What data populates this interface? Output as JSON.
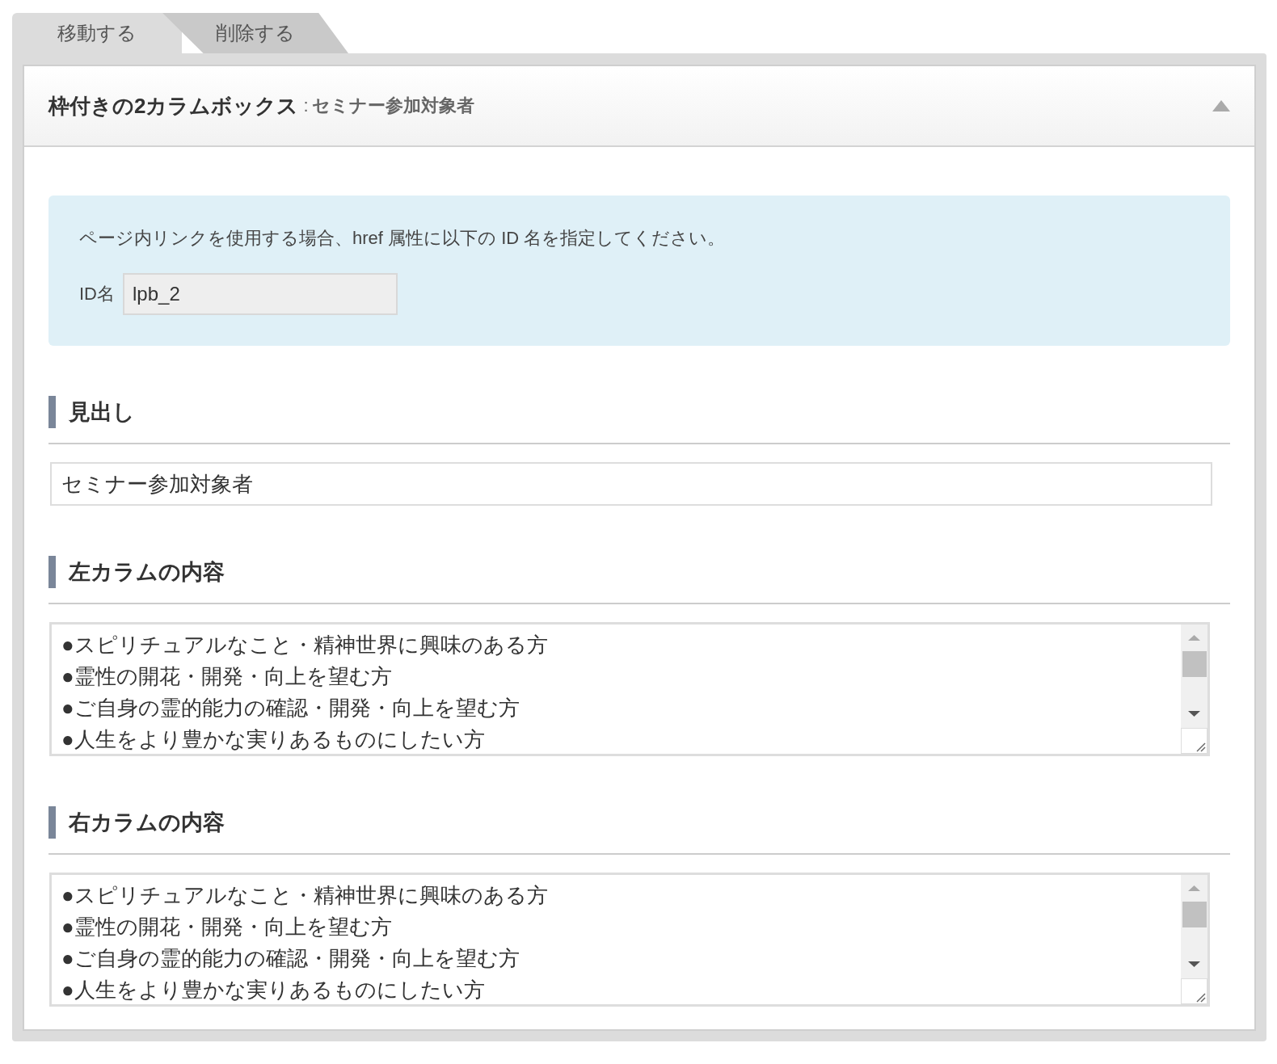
{
  "tabs": [
    {
      "label": "移動する"
    },
    {
      "label": "削除する"
    }
  ],
  "panel": {
    "title": "枠付きの2カラムボックス",
    "separator": ":",
    "subtitle": "セミナー参加対象者",
    "expanded": true
  },
  "notice": {
    "text": "ページ内リンクを使用する場合、href 属性に以下の ID 名を指定してください。",
    "id_label": "ID名",
    "id_value": "lpb_2"
  },
  "fields": [
    {
      "kind": "input",
      "label": "見出し",
      "value": "セミナー参加対象者"
    },
    {
      "kind": "textarea",
      "label": "左カラムの内容",
      "lines": [
        "●スピリチュアルなこと・精神世界に興味のある方",
        "●霊性の開花・開発・向上を望む方",
        "●ご自身の霊的能力の確認・開発・向上を望む方",
        "●人生をより豊かな実りあるものにしたい方"
      ]
    },
    {
      "kind": "textarea",
      "label": "右カラムの内容",
      "lines": [
        "●スピリチュアルなこと・精神世界に興味のある方",
        "●霊性の開花・開発・向上を望む方",
        "●ご自身の霊的能力の確認・開発・向上を望む方",
        "●人生をより豊かな実りあるものにしたい方"
      ]
    }
  ]
}
